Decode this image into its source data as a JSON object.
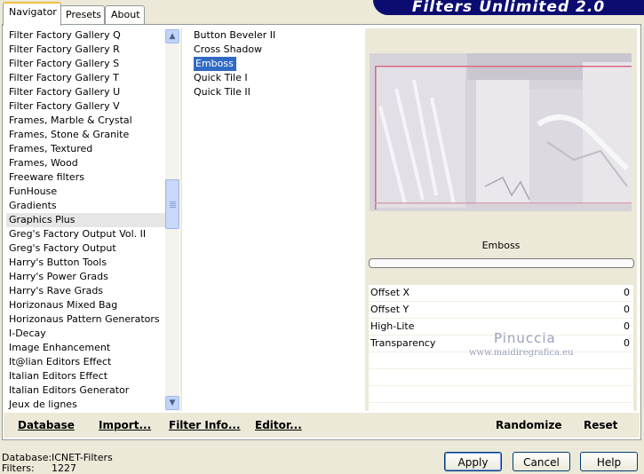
{
  "brand": "Filters Unlimited 2.0",
  "tabs": [
    {
      "label": "Navigator",
      "active": true
    },
    {
      "label": "Presets",
      "active": false
    },
    {
      "label": "About",
      "active": false
    }
  ],
  "categories": [
    "Filter Factory Gallery Q",
    "Filter Factory Gallery R",
    "Filter Factory Gallery S",
    "Filter Factory Gallery T",
    "Filter Factory Gallery U",
    "Filter Factory Gallery V",
    "Frames, Marble & Crystal",
    "Frames, Stone & Granite",
    "Frames, Textured",
    "Frames, Wood",
    "Freeware filters",
    "FunHouse",
    "Gradients",
    "Graphics Plus",
    "Greg's Factory Output Vol. II",
    "Greg's Factory Output",
    "Harry's Button Tools",
    "Harry's Power Grads",
    "Harry's Rave Grads",
    "Horizonaus Mixed Bag",
    "Horizonaus Pattern Generators",
    "I-Decay",
    "Image Enhancement",
    "It@lian Editors Effect",
    "Italian Editors Effect",
    "Italian Editors Generator",
    "Jeux de lignes"
  ],
  "selected_category": "Graphics Plus",
  "filters": [
    "Button Beveler II",
    "Cross Shadow",
    "Emboss",
    "Quick Tile I",
    "Quick Tile II"
  ],
  "selected_filter": "Emboss",
  "preview_title": "Emboss",
  "params": [
    {
      "label": "Offset X",
      "value": "0"
    },
    {
      "label": "Offset Y",
      "value": "0"
    },
    {
      "label": "High-Lite",
      "value": "0"
    },
    {
      "label": "Transparency",
      "value": "0"
    },
    {
      "label": "",
      "value": ""
    },
    {
      "label": "",
      "value": ""
    },
    {
      "label": "",
      "value": ""
    },
    {
      "label": "",
      "value": ""
    }
  ],
  "watermark": {
    "name": "Pinuccia",
    "url": "www.maidiregrafica.eu"
  },
  "toolbar": {
    "database": "Database",
    "import": "Import...",
    "filter_info": "Filter Info...",
    "editor": "Editor...",
    "randomize": "Randomize",
    "reset": "Reset"
  },
  "status": {
    "database_label": "Database:",
    "database_value": "ICNET-Filters",
    "filters_label": "Filters:",
    "filters_value": "1227"
  },
  "buttons": {
    "apply": "Apply",
    "cancel": "Cancel",
    "help": "Help"
  },
  "scroll": {
    "position_fraction": 0.45
  }
}
